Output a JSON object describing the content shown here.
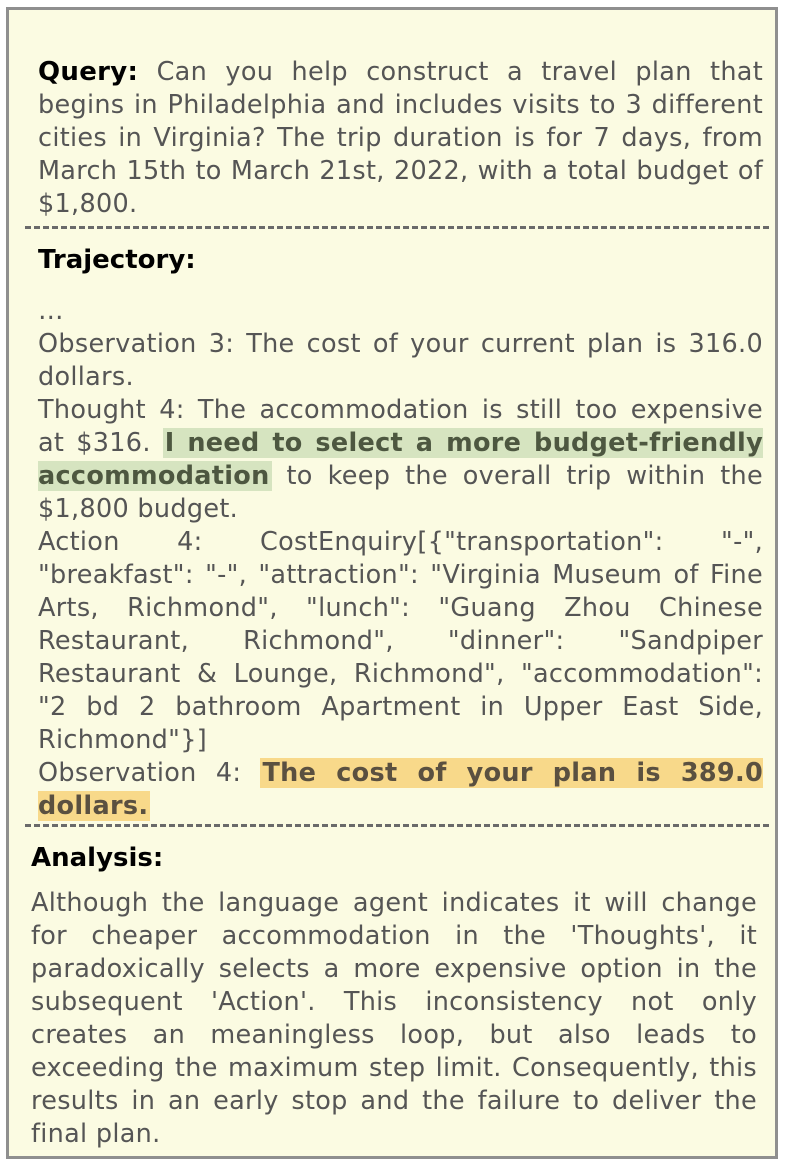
{
  "query": {
    "label": "Query:",
    "text": "Can you help construct a travel plan that begins in Philadelphia and includes visits to 3 different cities in Virginia? The trip duration is for 7 days, from March 15th to March 21st, 2022, with a total budget of $1,800."
  },
  "trajectory": {
    "label": "Trajectory:",
    "ellipsis": "…",
    "observation3": "Observation 3: The cost of your current plan is 316.0 dollars.",
    "thought4_prefix": "Thought 4: The accommodation is still too expensive at $316.",
    "thought4_highlight": "I need to select a more budget-friendly accommodation",
    "thought4_suffix": "to keep the overall trip within the $1,800 budget.",
    "action4": "Action 4: CostEnquiry[{\"transportation\": \"-\", \"breakfast\": \"-\", \"attraction\": \"Virginia Museum of Fine Arts, Richmond\", \"lunch\": \"Guang Zhou Chinese Restaurant, Richmond\", \"dinner\": \"Sandpiper Restaurant & Lounge, Richmond\", \"accommodation\": \"2 bd 2 bathroom Apartment in Upper East Side, Richmond\"}]",
    "observation4_prefix": "Observation 4:",
    "observation4_highlight": "The cost of your plan is 389.0 dollars."
  },
  "analysis": {
    "label": "Analysis:",
    "text": "Although the language agent indicates it will change for cheaper accommodation in the 'Thoughts', it paradoxically selects a more expensive option in the subsequent 'Action'. This inconsistency not only creates an meaningless loop, but also leads to exceeding the maximum step limit. Consequently, this results in an early stop and the failure to deliver the final plan."
  },
  "colors": {
    "background": "#fbfbe2",
    "border": "#8f8f8f",
    "text": "#555555",
    "highlight_green": "#d6e4c0",
    "highlight_orange": "#f8d98a"
  }
}
